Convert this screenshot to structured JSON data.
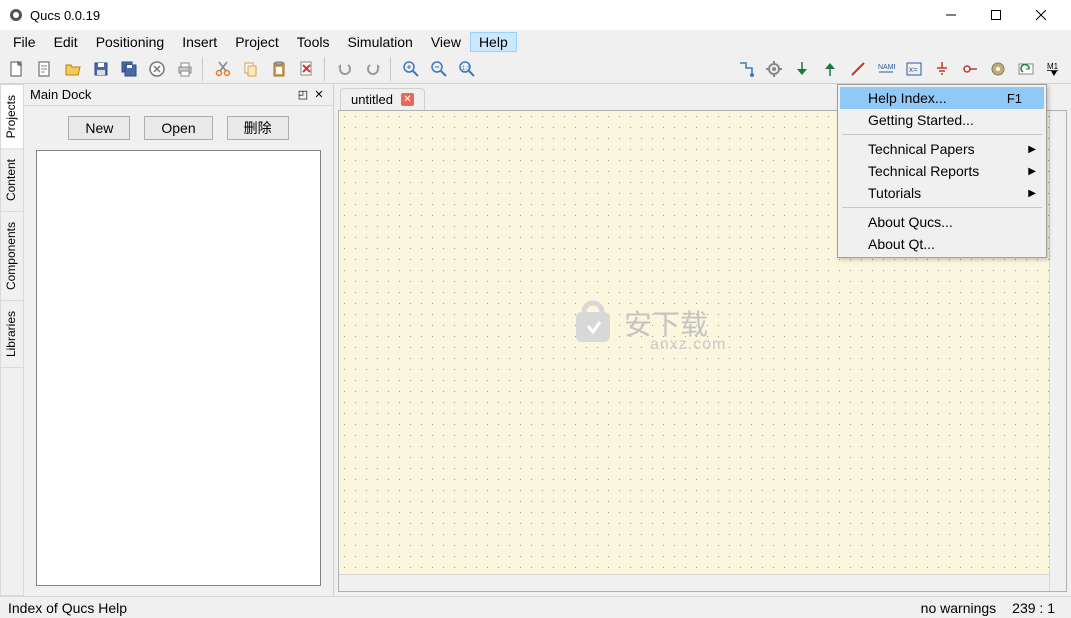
{
  "window": {
    "title": "Qucs 0.0.19"
  },
  "menubar": [
    "File",
    "Edit",
    "Positioning",
    "Insert",
    "Project",
    "Tools",
    "Simulation",
    "View",
    "Help"
  ],
  "menubar_open": "Help",
  "help_menu": {
    "items": [
      {
        "label": "Help Index...",
        "shortcut": "F1",
        "highlight": true
      },
      {
        "label": "Getting Started..."
      },
      {
        "sep": true
      },
      {
        "label": "Technical Papers",
        "submenu": true
      },
      {
        "label": "Technical Reports",
        "submenu": true
      },
      {
        "label": "Tutorials",
        "submenu": true
      },
      {
        "sep": true
      },
      {
        "label": "About Qucs..."
      },
      {
        "label": "About Qt..."
      }
    ]
  },
  "dock": {
    "title": "Main Dock",
    "buttons": {
      "new": "New",
      "open": "Open",
      "delete": "删除"
    }
  },
  "side_tabs": [
    "Projects",
    "Content",
    "Components",
    "Libraries"
  ],
  "side_tab_active": "Projects",
  "document": {
    "tab_name": "untitled"
  },
  "statusbar": {
    "left": "Index of Qucs Help",
    "warnings": "no warnings",
    "coords": "239 : 1"
  },
  "watermark": {
    "main": "安下载",
    "sub": "anxz.com"
  }
}
